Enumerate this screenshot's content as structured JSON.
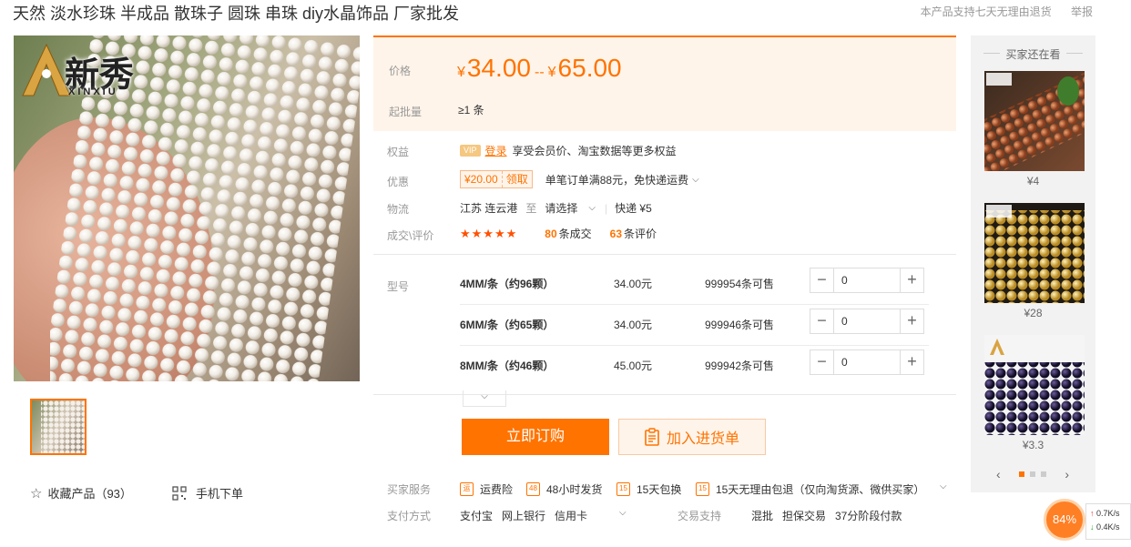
{
  "product": {
    "title": "天然 淡水珍珠 半成品 散珠子 圆珠 串珠 diy水晶饰品 厂家批发",
    "return_note": "本产品支持七天无理由退货",
    "report": "举报"
  },
  "gallery": {
    "logo_text": "新秀",
    "logo_sub": "XINXIU",
    "favorite_label": "收藏产品（93）",
    "mobile_order_label": "手机下单"
  },
  "price": {
    "label": "价格",
    "currency": "¥",
    "min": "34.00",
    "max": "65.00",
    "dash": "--",
    "batch_label": "起批量",
    "batch_value": "≥1 条"
  },
  "benefits": {
    "label": "权益",
    "vip": "VIP",
    "login": "登录",
    "text": "享受会员价、淘宝数据等更多权益"
  },
  "discount": {
    "label": "优惠",
    "coupon_amount": "¥20.00",
    "coupon_get": "领取",
    "text": "单笔订单满88元，免快递运费"
  },
  "logistics": {
    "label": "物流",
    "from": "江苏 连云港",
    "to_label": "至",
    "select": "请选择",
    "express": "快递 ¥5"
  },
  "reviews": {
    "label": "成交\\评价",
    "stars": "★★★★★",
    "deals_count": "80",
    "deals_label": "条成交",
    "reviews_count": "63",
    "reviews_label": "条评价"
  },
  "sku": {
    "label": "型号",
    "rows": [
      {
        "name": "4MM/条（约96颗）",
        "price": "34.00元",
        "stock": "999954条可售",
        "qty": "0"
      },
      {
        "name": "6MM/条（约65颗）",
        "price": "34.00元",
        "stock": "999946条可售",
        "qty": "0"
      },
      {
        "name": "8MM/条（约46颗）",
        "price": "45.00元",
        "stock": "999942条可售",
        "qty": "0"
      }
    ]
  },
  "actions": {
    "buy_now": "立即订购",
    "add_to_list": "加入进货单"
  },
  "services": {
    "label": "买家服务",
    "items": [
      {
        "icon": "运",
        "text": "运费险"
      },
      {
        "icon": "48",
        "text": "48小时发货"
      },
      {
        "icon": "15",
        "text": "15天包换"
      },
      {
        "icon": "15",
        "text": "15天无理由包退（仅向淘货源、微供买家）"
      }
    ]
  },
  "payment": {
    "label": "支付方式",
    "methods": "支付宝   网上银行   信用卡",
    "trade_label": "交易支持",
    "trade_items": "混批   担保交易   37分阶段付款"
  },
  "sidebar": {
    "title": "买家还在看",
    "items": [
      {
        "price": "¥4"
      },
      {
        "price": "¥28"
      },
      {
        "price": "¥3.3"
      }
    ]
  },
  "widget": {
    "percent": "84%",
    "up_speed": "0.7K/s",
    "down_speed": "0.4K/s"
  },
  "colors": {
    "accent": "#ff7300",
    "price_bg": "#fff4ea"
  }
}
